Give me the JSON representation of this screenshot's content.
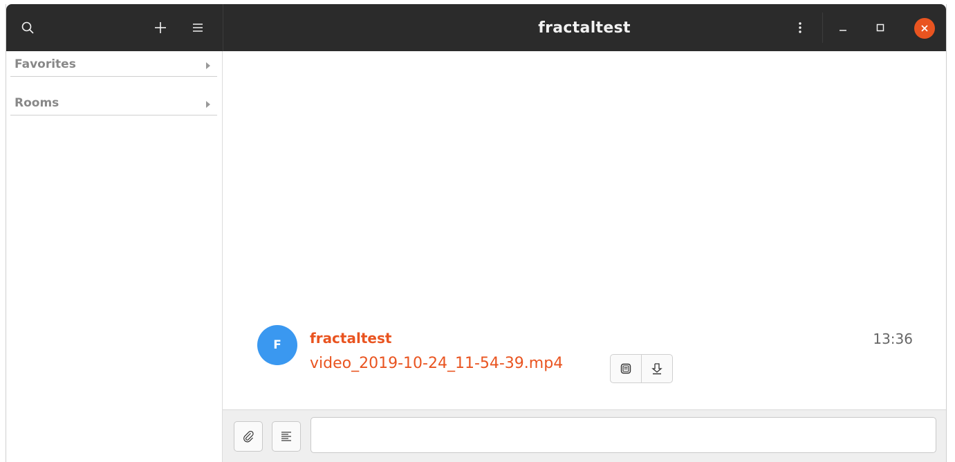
{
  "window": {
    "title": "fractaltest"
  },
  "headerbar": {
    "icons": {
      "search": "search-icon",
      "add": "plus-icon",
      "menu": "hamburger-icon",
      "more": "vertical-dots-icon",
      "minimize": "minimize-icon",
      "maximize": "maximize-icon",
      "close": "close-icon"
    }
  },
  "sidebar": {
    "sections": [
      {
        "label": "Favorites"
      },
      {
        "label": "Rooms"
      }
    ]
  },
  "message": {
    "avatar_initial": "F",
    "sender": "fractaltest",
    "time": "13:36",
    "filename": "video_2019-10-24_11-54-39.mp4"
  },
  "composer": {
    "input_value": "",
    "input_placeholder": ""
  },
  "colors": {
    "accent": "#e95420",
    "avatar": "#3a98f0",
    "headerbar": "#2b2b2b"
  }
}
